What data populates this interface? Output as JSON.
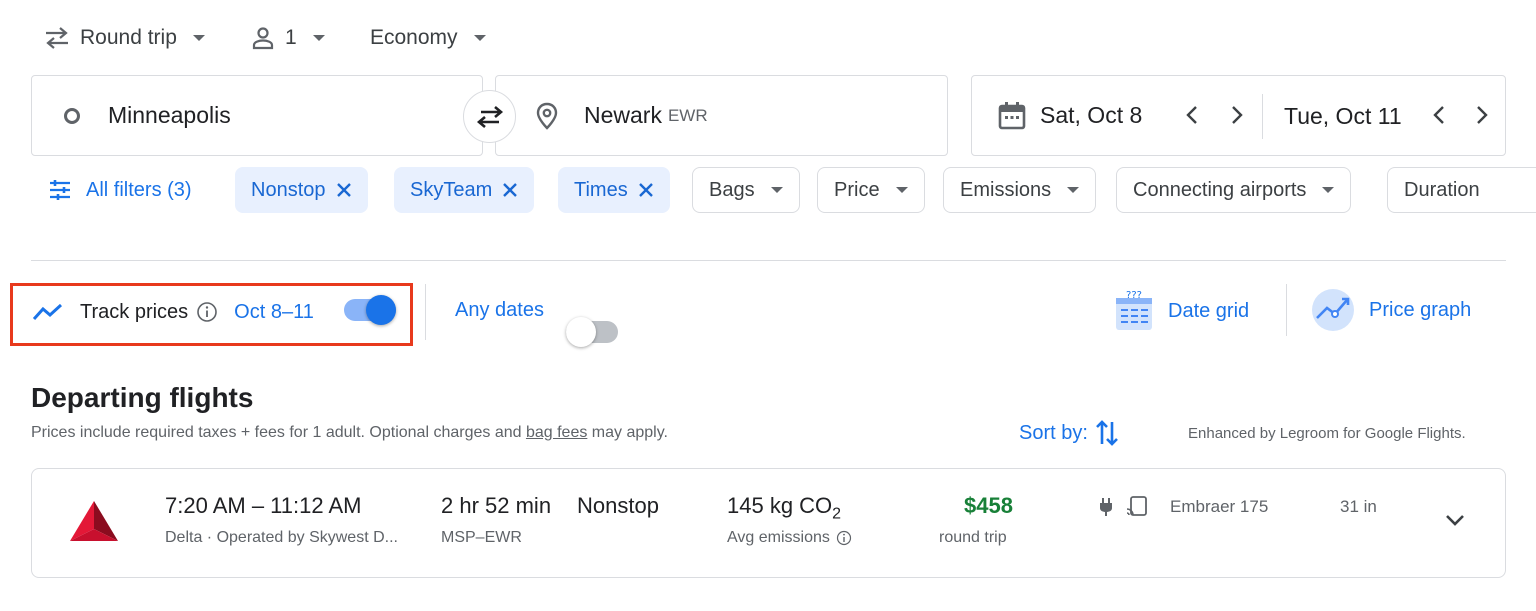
{
  "search_bar": {
    "trip_type": "Round trip",
    "passengers": "1",
    "cabin_class": "Economy",
    "origin": "Minneapolis",
    "destination": "Newark",
    "destination_code": "EWR",
    "depart_date": "Sat, Oct 8",
    "return_date": "Tue, Oct 11"
  },
  "filters": {
    "all_filters": "All filters (3)",
    "active_chips": [
      "Nonstop",
      "SkyTeam",
      "Times"
    ],
    "dropdown_chips": [
      "Bags",
      "Price",
      "Emissions",
      "Connecting airports",
      "Duration"
    ]
  },
  "tracking": {
    "track_label": "Track prices",
    "track_dates": "Oct 8–11",
    "track_on": true,
    "any_dates_label": "Any dates",
    "any_dates_on": false,
    "highlight_color": "#e8391d",
    "date_grid_label": "Date grid",
    "price_graph_label": "Price graph"
  },
  "results": {
    "heading": "Departing flights",
    "note_before": "Prices include required taxes + fees for 1 adult. Optional charges and ",
    "note_link": "bag fees",
    "note_after": " may apply.",
    "sort_label": "Sort by:",
    "legroom_note": "Enhanced by Legroom for Google Flights.",
    "flights": [
      {
        "airline_logo": "delta-logo",
        "times": "7:20 AM – 11:12 AM",
        "airline": "Delta · Operated by Skywest D...",
        "duration": "2 hr 52 min",
        "route": "MSP–EWR",
        "stops": "Nonstop",
        "emissions_value": "145 kg CO",
        "emissions_sub": "2",
        "emissions_label": "Avg emissions",
        "price": "$458",
        "price_type": "round trip",
        "aircraft": "Embraer 175",
        "legroom": "31 in"
      }
    ]
  },
  "colors": {
    "accent": "#1a73e8",
    "price_green": "#188038",
    "delta_red": "#c8102e"
  }
}
